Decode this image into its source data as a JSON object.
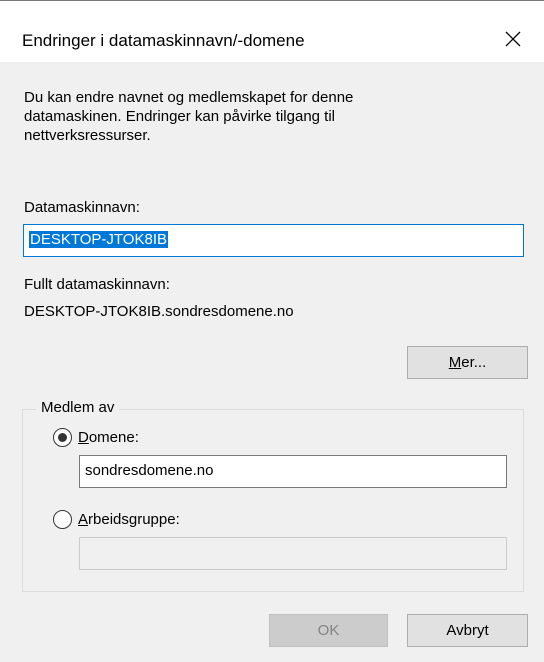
{
  "window": {
    "title": "Endringer i datamaskinnavn/-domene"
  },
  "description": "Du kan endre navnet og medlemskapet for denne datamaskinen. Endringer kan påvirke tilgang til nettverksressurser.",
  "computer_name": {
    "label": "Datamaskinnavn:",
    "value": "DESKTOP-JTOK8IB"
  },
  "full_name": {
    "label": "Fullt datamaskinnavn:",
    "value": "DESKTOP-JTOK8IB.sondresdomene.no"
  },
  "more_button": {
    "label_underlined": "M",
    "label_rest": "er..."
  },
  "member_of": {
    "legend": "Medlem av",
    "domain": {
      "label_underlined": "D",
      "label_rest": "omene:",
      "selected": true,
      "value": "sondresdomene.no"
    },
    "workgroup": {
      "label_underlined": "A",
      "label_rest": "rbeidsgruppe:",
      "selected": false,
      "value": ""
    }
  },
  "buttons": {
    "ok": "OK",
    "cancel": "Avbryt"
  }
}
